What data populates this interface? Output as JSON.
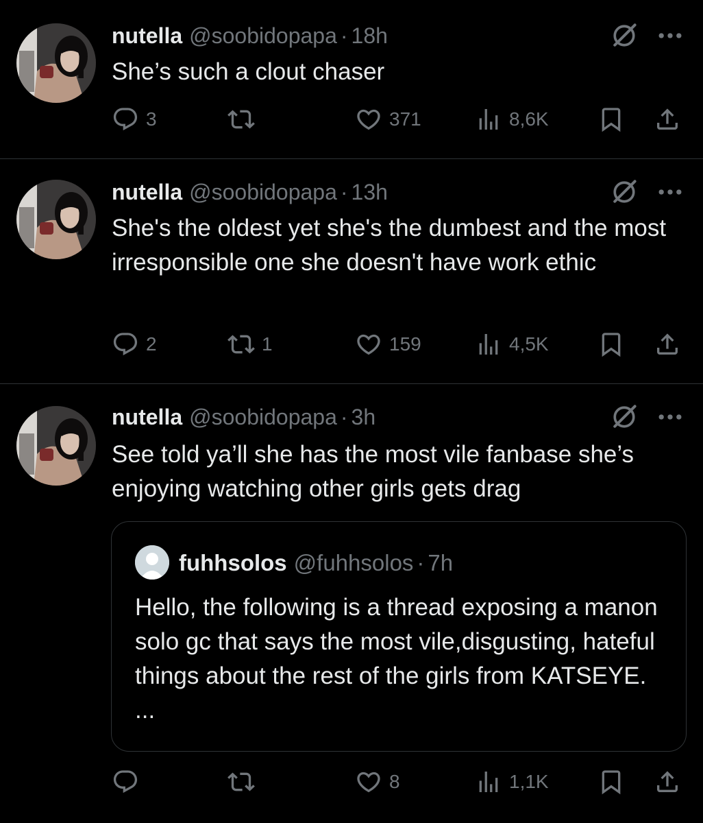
{
  "tweets": [
    {
      "name": "nutella",
      "handle": "@soobidopapa",
      "dot": "·",
      "time": "18h",
      "text": "She’s such a clout chaser",
      "replies": "3",
      "reposts": "",
      "likes": "371",
      "views": "8,6K"
    },
    {
      "name": "nutella",
      "handle": "@soobidopapa",
      "dot": "·",
      "time": "13h",
      "text": "She's the oldest yet she's the dumbest and the most irresponsible one she doesn't have work ethic",
      "replies": "2",
      "reposts": "1",
      "likes": "159",
      "views": "4,5K"
    },
    {
      "name": "nutella",
      "handle": "@soobidopapa",
      "dot": "·",
      "time": "3h",
      "text": "See told ya’ll she has the most vile fanbase she’s enjoying watching other girls gets drag",
      "replies": "",
      "reposts": "",
      "likes": "8",
      "views": "1,1K",
      "quote": {
        "name": "fuhhsolos",
        "handle": "@fuhhsolos",
        "dot": "·",
        "time": "7h",
        "text": "Hello, the following is a thread exposing a manon solo gc that says the most vile,disgusting, hateful things about the rest of the girls from KATSEYE. ..."
      }
    }
  ],
  "icons": {
    "reply": "reply-icon",
    "repost": "repost-icon",
    "like": "heart-icon",
    "views": "views-icon",
    "bookmark": "bookmark-icon",
    "share": "share-icon",
    "grok": "grok-icon",
    "more": "more-icon"
  },
  "colors": {
    "background": "#000000",
    "text": "#e7e9ea",
    "muted": "#71767b",
    "divider": "#2f3336"
  }
}
